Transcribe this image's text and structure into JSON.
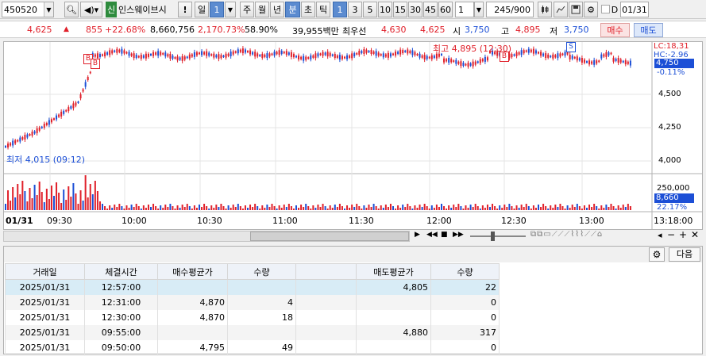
{
  "toolbar": {
    "code": "450520",
    "market_badge": "신",
    "stock_name": "인스웨이브시",
    "warn_mark": "!",
    "period_unit": "일",
    "period_value": "1",
    "periods": [
      "주",
      "월",
      "년",
      "분",
      "초",
      "틱"
    ],
    "selected_period": "분",
    "intervals": [
      "1",
      "3",
      "5",
      "10",
      "15",
      "30",
      "45",
      "60"
    ],
    "selected_interval": "1",
    "custom_interval": "1",
    "count": "245/900",
    "date_checkbox_label": "D",
    "date": "01/31"
  },
  "info": {
    "price": "4,625",
    "arrow": "▲",
    "change": "855",
    "change_pct": "+22.68%",
    "volume": "8,660,756",
    "volume_ratio": "2,170.73%",
    "turnover_ratio": "58.90%",
    "amount": "39,955백만",
    "best_ask_label": "최우선",
    "best_ask": "4,630",
    "best_bid": "4,625",
    "open_label": "시",
    "open": "3,750",
    "high_label": "고",
    "high": "4,895",
    "low_label": "저",
    "low": "3,750",
    "buy_button": "매수",
    "sell_button": "매도"
  },
  "chart": {
    "high_annotation": "최고 4,895 (12:30)",
    "low_annotation": "최저 4,015 (09:12)",
    "lc_label": "LC:18,31",
    "hc_label": "HC:-2.96",
    "current_price_tag": "4,750",
    "current_change_tag": "-0.11%",
    "price_axis": [
      "4,500",
      "4,250",
      "4,000"
    ],
    "volume_axis_top": "250,000",
    "volume_tag": "8,660",
    "volume_pct_tag": "22.17%",
    "date_label": "01/31",
    "time_labels": [
      "09:30",
      "10:00",
      "10:30",
      "11:00",
      "11:30",
      "12:00",
      "12:30",
      "13:00"
    ],
    "end_time": "13:18:00",
    "markers": [
      "B",
      "B",
      "B",
      "S"
    ]
  },
  "grid": {
    "next_button": "다음",
    "columns": [
      "거래일",
      "체결시간",
      "매수평균가",
      "수량",
      "",
      "매도평균가",
      "수량"
    ],
    "rows": [
      [
        "2025/01/31",
        "12:57:00",
        "",
        "",
        "",
        "4,805",
        "22"
      ],
      [
        "2025/01/31",
        "12:31:00",
        "4,870",
        "4",
        "",
        "",
        "0"
      ],
      [
        "2025/01/31",
        "12:30:00",
        "4,870",
        "18",
        "",
        "",
        "0"
      ],
      [
        "2025/01/31",
        "09:55:00",
        "",
        "",
        "",
        "4,880",
        "317"
      ],
      [
        "2025/01/31",
        "09:50:00",
        "4,795",
        "49",
        "",
        "",
        "0"
      ]
    ]
  },
  "colors": {
    "up": "#e0202a",
    "down": "#1c4fd6",
    "accent": "#5b8bd0"
  }
}
